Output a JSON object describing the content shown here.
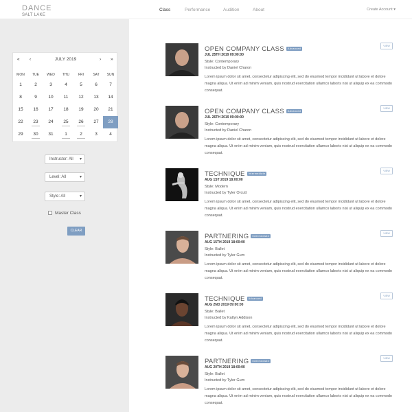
{
  "logo": {
    "line1": "DANCE",
    "line2": "SALT LAKE"
  },
  "nav": {
    "items": [
      "Class",
      "Performance",
      "Audition",
      "About"
    ],
    "account": "Create Account ▾"
  },
  "calendar": {
    "month": "JULY 2019",
    "prev_year": "«",
    "prev": "‹",
    "next": "›",
    "next_year": "»",
    "days_of_week": [
      "MON",
      "TUE",
      "WED",
      "THU",
      "FRI",
      "SAT",
      "SUN"
    ],
    "weeks": [
      [
        "1",
        "2",
        "3",
        "4",
        "5",
        "6",
        "7"
      ],
      [
        "8",
        "9",
        "10",
        "11",
        "12",
        "13",
        "14"
      ],
      [
        "15",
        "16",
        "17",
        "18",
        "19",
        "20",
        "21"
      ],
      [
        "22",
        "23",
        "24",
        "25",
        "26",
        "27",
        "28"
      ],
      [
        "29",
        "30",
        "31",
        "1",
        "2",
        "3",
        "4"
      ]
    ],
    "selected": "28"
  },
  "filters": {
    "instructor": "Instructor: All",
    "level": "Level: All",
    "style": "Style: All",
    "master_class": "Master Class",
    "clear": "CLEAR"
  },
  "classes": [
    {
      "title": "OPEN COMPANY CLASS",
      "level": "Advanced",
      "date": "JUL 25TH 2019 09:00:00",
      "style": "Style: Contemporary",
      "instructor": "Instructed by Daniel Charon",
      "desc": "Lorem ipsum dolor sit amet, consectetur adipiscing elit, sed do eiusmod tempor incididunt ut labore et dolore magna aliqua. Ut enim ad minim veniam, quis nostrud exercitation ullamco laboris nisi ut aliquip ex ea commodo consequat.",
      "view": "VIEW",
      "photo": "man-portrait"
    },
    {
      "title": "OPEN COMPANY CLASS",
      "level": "Advanced",
      "date": "JUL 26TH 2019 09:00:00",
      "style": "Style: Contemporary",
      "instructor": "Instructed by Daniel Charon",
      "desc": "Lorem ipsum dolor sit amet, consectetur adipiscing elit, sed do eiusmod tempor incididunt ut labore et dolore magna aliqua. Ut enim ad minim veniam, quis nostrud exercitation ullamco laboris nisi ut aliquip ex ea commodo consequat.",
      "view": "VIEW",
      "photo": "man-portrait"
    },
    {
      "title": "TECHNIQUE",
      "level": "Intermediate",
      "date": "AUG 1ST 2019 18:00:00",
      "style": "Style: Modern",
      "instructor": "Instructed by Tyler Orcutt",
      "desc": "Lorem ipsum dolor sit amet, consectetur adipiscing elit, sed do eiusmod tempor incididunt ut labore et dolore magna aliqua. Ut enim ad minim veniam, quis nostrud exercitation ullamco laboris nisi ut aliquip ex ea commodo consequat.",
      "view": "VIEW",
      "photo": "dancer-bw"
    },
    {
      "title": "PARTNERING",
      "level": "Intermediate",
      "date": "AUG 15TH 2019 18:00:00",
      "style": "Style: Ballet",
      "instructor": "Instructed by Tyler Gum",
      "desc": "Lorem ipsum dolor sit amet, consectetur adipiscing elit, sed do eiusmod tempor incididunt ut labore et dolore magna aliqua. Ut enim ad minim veniam, quis nostrud exercitation ullamco laboris nisi ut aliquip ex ea commodo consequat.",
      "view": "VIEW",
      "photo": "man-portrait-2"
    },
    {
      "title": "TECHNIQUE",
      "level": "Advanced",
      "date": "AUG 2ND 2019 09:00:00",
      "style": "Style: Ballet",
      "instructor": "Instructed by Katlyn Addison",
      "desc": "Lorem ipsum dolor sit amet, consectetur adipiscing elit, sed do eiusmod tempor incididunt ut labore et dolore magna aliqua. Ut enim ad minim veniam, quis nostrud exercitation ullamco laboris nisi ut aliquip ex ea commodo consequat.",
      "view": "VIEW",
      "photo": "woman-portrait"
    },
    {
      "title": "PARTNERING",
      "level": "Intermediate",
      "date": "AUG 20TH 2019 18:00:00",
      "style": "Style: Ballet",
      "instructor": "Instructed by Tyler Gum",
      "desc": "Lorem ipsum dolor sit amet, consectetur adipiscing elit, sed do eiusmod tempor incididunt ut labore et dolore magna aliqua. Ut enim ad minim veniam, quis nostrud exercitation ullamco laboris nisi ut aliquip ex ea commodo consequat.",
      "view": "VIEW",
      "photo": "man-portrait-2"
    }
  ],
  "colors": {
    "accent": "#7f9ec2",
    "sidebar": "#ececec"
  }
}
